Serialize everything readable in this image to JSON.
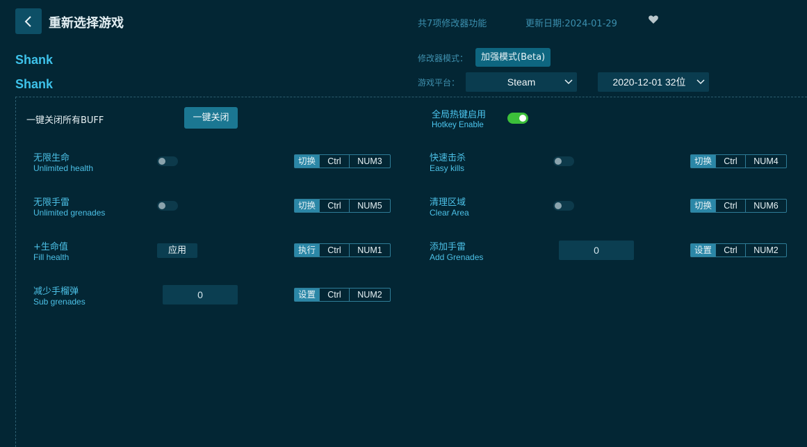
{
  "header": {
    "title": "重新选择游戏",
    "feature_count": "共7项修改器功能",
    "update_date": "更新日期:2024-01-29"
  },
  "game": {
    "name_1": "Shank",
    "name_2": "Shank"
  },
  "settings": {
    "mode_label": "修改器模式：",
    "mode_value": "加强模式(Beta)",
    "platform_label": "游戏平台：",
    "platform_value": "Steam",
    "version_value": "2020-12-01 32位"
  },
  "global": {
    "all_off_label": "一键关闭所有BUFF",
    "all_off_button": "一键关闭",
    "hotkey_title": "全局热键启用",
    "hotkey_subtitle": "Hotkey Enable",
    "hotkey_enabled": true
  },
  "features": [
    {
      "cn": "无限生命",
      "en": "Unlimited health",
      "control": "toggle",
      "action": "切换",
      "key1": "Ctrl",
      "key2": "NUM3"
    },
    {
      "cn": "快速击杀",
      "en": "Easy kills",
      "control": "toggle",
      "action": "切换",
      "key1": "Ctrl",
      "key2": "NUM4"
    },
    {
      "cn": "无限手雷",
      "en": "Unlimited grenades",
      "control": "toggle",
      "action": "切换",
      "key1": "Ctrl",
      "key2": "NUM5"
    },
    {
      "cn": "清理区域",
      "en": "Clear Area",
      "control": "toggle",
      "action": "切换",
      "key1": "Ctrl",
      "key2": "NUM6"
    },
    {
      "cn": "+生命值",
      "en": "Fill health",
      "control": "button",
      "button_label": "应用",
      "action": "执行",
      "key1": "Ctrl",
      "key2": "NUM1"
    },
    {
      "cn": "添加手雷",
      "en": "Add Grenades",
      "control": "input",
      "value": "0",
      "action": "设置",
      "key1": "Ctrl",
      "key2": "NUM2"
    },
    {
      "cn": "减少手榴弹",
      "en": "Sub grenades",
      "control": "input",
      "value": "0",
      "action": "设置",
      "key1": "Ctrl",
      "key2": "NUM2"
    }
  ],
  "colors": {
    "background": "#032634",
    "accent": "#3ec2ea",
    "toggle_on": "#3cbf3a"
  },
  "icons": {
    "back": "chevron-left-icon",
    "favorite": "heart-icon",
    "dropdown": "chevron-down-icon"
  }
}
